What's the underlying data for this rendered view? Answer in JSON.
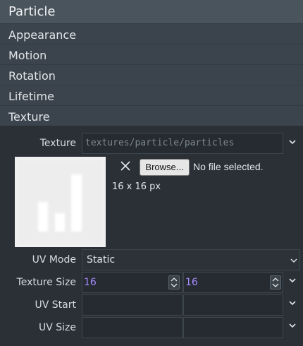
{
  "header": {
    "title": "Particle"
  },
  "sections": [
    {
      "label": "Appearance"
    },
    {
      "label": "Motion"
    },
    {
      "label": "Rotation"
    },
    {
      "label": "Lifetime"
    },
    {
      "label": "Texture"
    }
  ],
  "texture": {
    "label": "Texture",
    "path_value": "textures/particle/particles",
    "browse_label": "Browse...",
    "no_file_text": "No file selected.",
    "dimensions": "16 x 16 px"
  },
  "uv_mode": {
    "label": "UV Mode",
    "value": "Static"
  },
  "texture_size": {
    "label": "Texture Size",
    "width": "16",
    "height": "16"
  },
  "uv_start": {
    "label": "UV Start",
    "x": "",
    "y": ""
  },
  "uv_size": {
    "label": "UV Size",
    "x": "",
    "y": ""
  },
  "icons": {
    "chevron": "chevron-down-icon",
    "close": "close-icon",
    "spin": "spinner-arrows-icon"
  },
  "colors": {
    "header_bg": "#4a545d",
    "section_bg": "#3b444c",
    "panel_bg": "#2a3036",
    "number_text": "#a58cff"
  }
}
